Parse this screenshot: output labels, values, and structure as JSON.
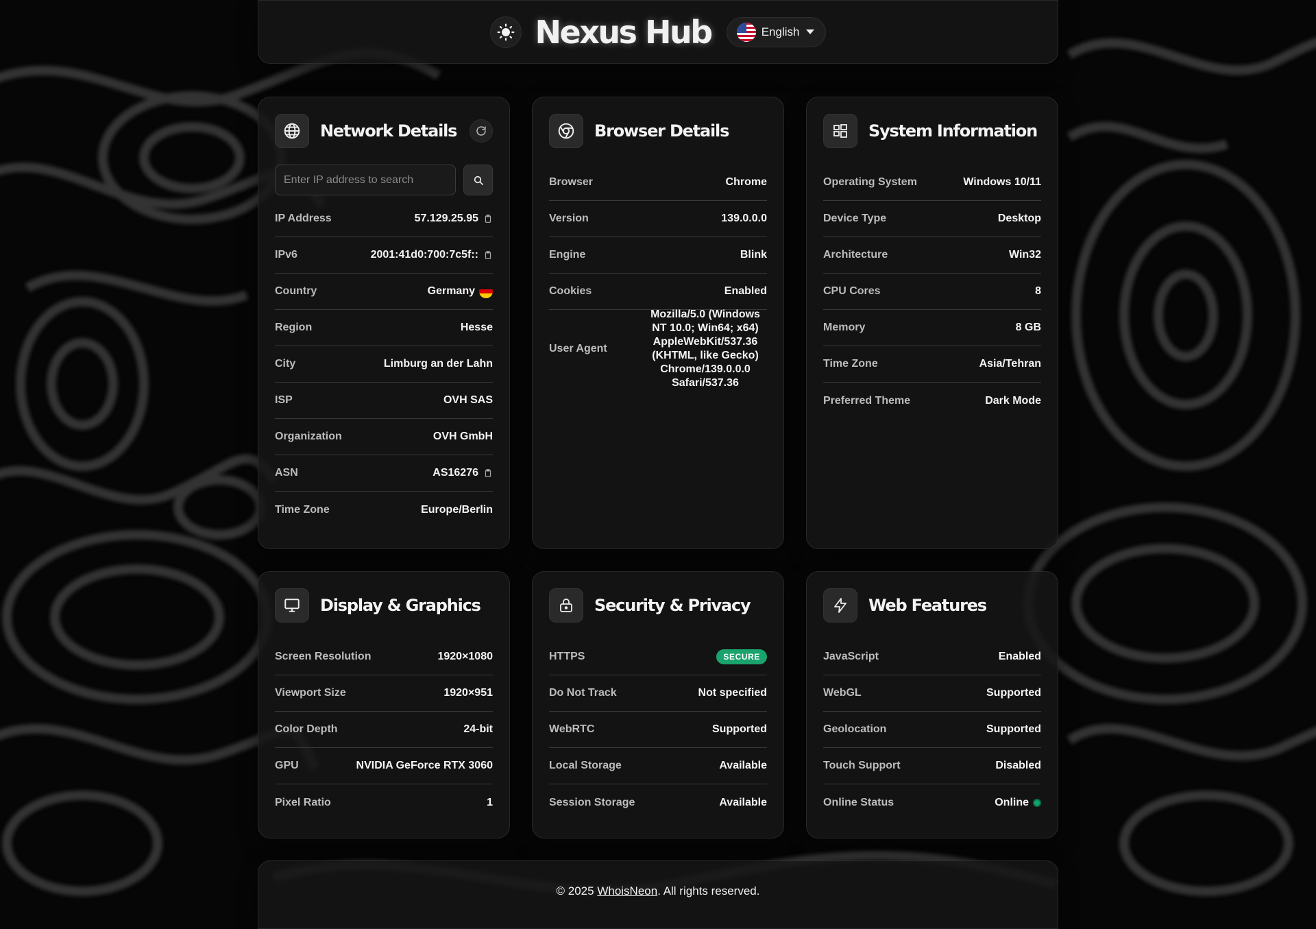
{
  "header": {
    "brand": "Nexus Hub",
    "language": "English"
  },
  "network": {
    "title": "Network Details",
    "search_placeholder": "Enter IP address to search",
    "rows": [
      {
        "label": "IP Address",
        "value": "57.129.25.95"
      },
      {
        "label": "IPv6",
        "value": "2001:41d0:700:7c5f::"
      },
      {
        "label": "Country",
        "value": "Germany"
      },
      {
        "label": "Region",
        "value": "Hesse"
      },
      {
        "label": "City",
        "value": "Limburg an der Lahn"
      },
      {
        "label": "ISP",
        "value": "OVH SAS"
      },
      {
        "label": "Organization",
        "value": "OVH GmbH"
      },
      {
        "label": "ASN",
        "value": "AS16276"
      },
      {
        "label": "Time Zone",
        "value": "Europe/Berlin"
      }
    ]
  },
  "browser": {
    "title": "Browser Details",
    "rows": [
      {
        "label": "Browser",
        "value": "Chrome"
      },
      {
        "label": "Version",
        "value": "139.0.0.0"
      },
      {
        "label": "Engine",
        "value": "Blink"
      },
      {
        "label": "Cookies",
        "value": "Enabled"
      },
      {
        "label": "User Agent",
        "value": "Mozilla/5.0 (Windows NT 10.0; Win64; x64) AppleWebKit/537.36 (KHTML, like Gecko) Chrome/139.0.0.0 Safari/537.36"
      }
    ]
  },
  "system": {
    "title": "System Information",
    "rows": [
      {
        "label": "Operating System",
        "value": "Windows 10/11"
      },
      {
        "label": "Device Type",
        "value": "Desktop"
      },
      {
        "label": "Architecture",
        "value": "Win32"
      },
      {
        "label": "CPU Cores",
        "value": "8"
      },
      {
        "label": "Memory",
        "value": "8 GB"
      },
      {
        "label": "Time Zone",
        "value": "Asia/Tehran"
      },
      {
        "label": "Preferred Theme",
        "value": "Dark Mode"
      }
    ]
  },
  "display": {
    "title": "Display & Graphics",
    "rows": [
      {
        "label": "Screen Resolution",
        "value": "1920×1080"
      },
      {
        "label": "Viewport Size",
        "value": "1920×951"
      },
      {
        "label": "Color Depth",
        "value": "24-bit"
      },
      {
        "label": "GPU",
        "value": "NVIDIA GeForce RTX 3060"
      },
      {
        "label": "Pixel Ratio",
        "value": "1"
      }
    ]
  },
  "security": {
    "title": "Security & Privacy",
    "rows": [
      {
        "label": "HTTPS",
        "value": "SECURE"
      },
      {
        "label": "Do Not Track",
        "value": "Not specified"
      },
      {
        "label": "WebRTC",
        "value": "Supported"
      },
      {
        "label": "Local Storage",
        "value": "Available"
      },
      {
        "label": "Session Storage",
        "value": "Available"
      }
    ]
  },
  "web": {
    "title": "Web Features",
    "rows": [
      {
        "label": "JavaScript",
        "value": "Enabled"
      },
      {
        "label": "WebGL",
        "value": "Supported"
      },
      {
        "label": "Geolocation",
        "value": "Supported"
      },
      {
        "label": "Touch Support",
        "value": "Disabled"
      },
      {
        "label": "Online Status",
        "value": "Online"
      }
    ]
  },
  "footer": {
    "prefix": "© 2025 ",
    "link": "WhoisNeon",
    "suffix": ". All rights reserved."
  },
  "colors": {
    "background": "#060606",
    "card": "#161616",
    "secure_badge": "#1aa36c",
    "online_dot": "#12a36a"
  },
  "icons": {
    "theme": "sun-icon",
    "network": "globe-icon",
    "browser": "chrome-icon",
    "system": "windows-icon",
    "display": "monitor-icon",
    "security": "lock-icon",
    "web": "bolt-icon"
  }
}
